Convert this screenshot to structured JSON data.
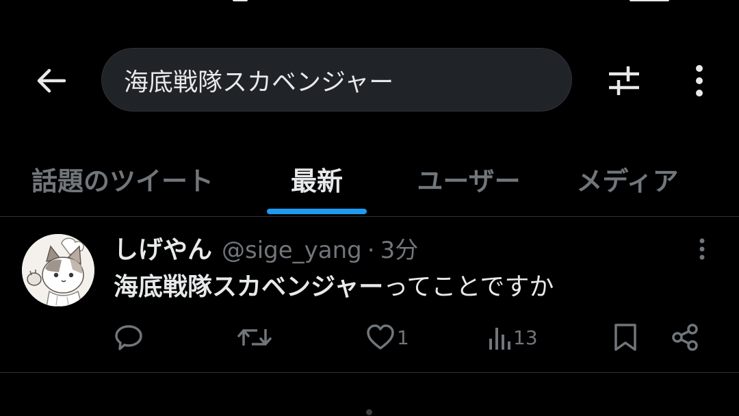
{
  "search": {
    "query": "海底戦隊スカベンジャー"
  },
  "tabs": [
    {
      "label": "話題のツイート",
      "active": false
    },
    {
      "label": "最新",
      "active": true
    },
    {
      "label": "ユーザー",
      "active": false
    },
    {
      "label": "メディア",
      "active": false
    }
  ],
  "tweet": {
    "display_name": "しげやん",
    "handle": "@sige_yang",
    "separator": "·",
    "time": "3分",
    "text_highlight": "海底戦隊スカベンジャー",
    "text_rest": "ってことですか",
    "likes": "1",
    "views": "13"
  },
  "icons": {
    "back": "arrow-left-icon",
    "filter": "sliders-icon",
    "more": "vertical-ellipsis-icon",
    "reply": "speech-bubble-icon",
    "retweet": "retweet-icon",
    "like": "heart-icon",
    "views": "bar-chart-icon",
    "bookmark": "bookmark-icon",
    "share": "share-icon"
  },
  "colors": {
    "background": "#000000",
    "accent": "#1d9bf0",
    "primary_text": "#e7e9ea",
    "secondary_text": "#71767b",
    "search_bg": "#202327"
  }
}
